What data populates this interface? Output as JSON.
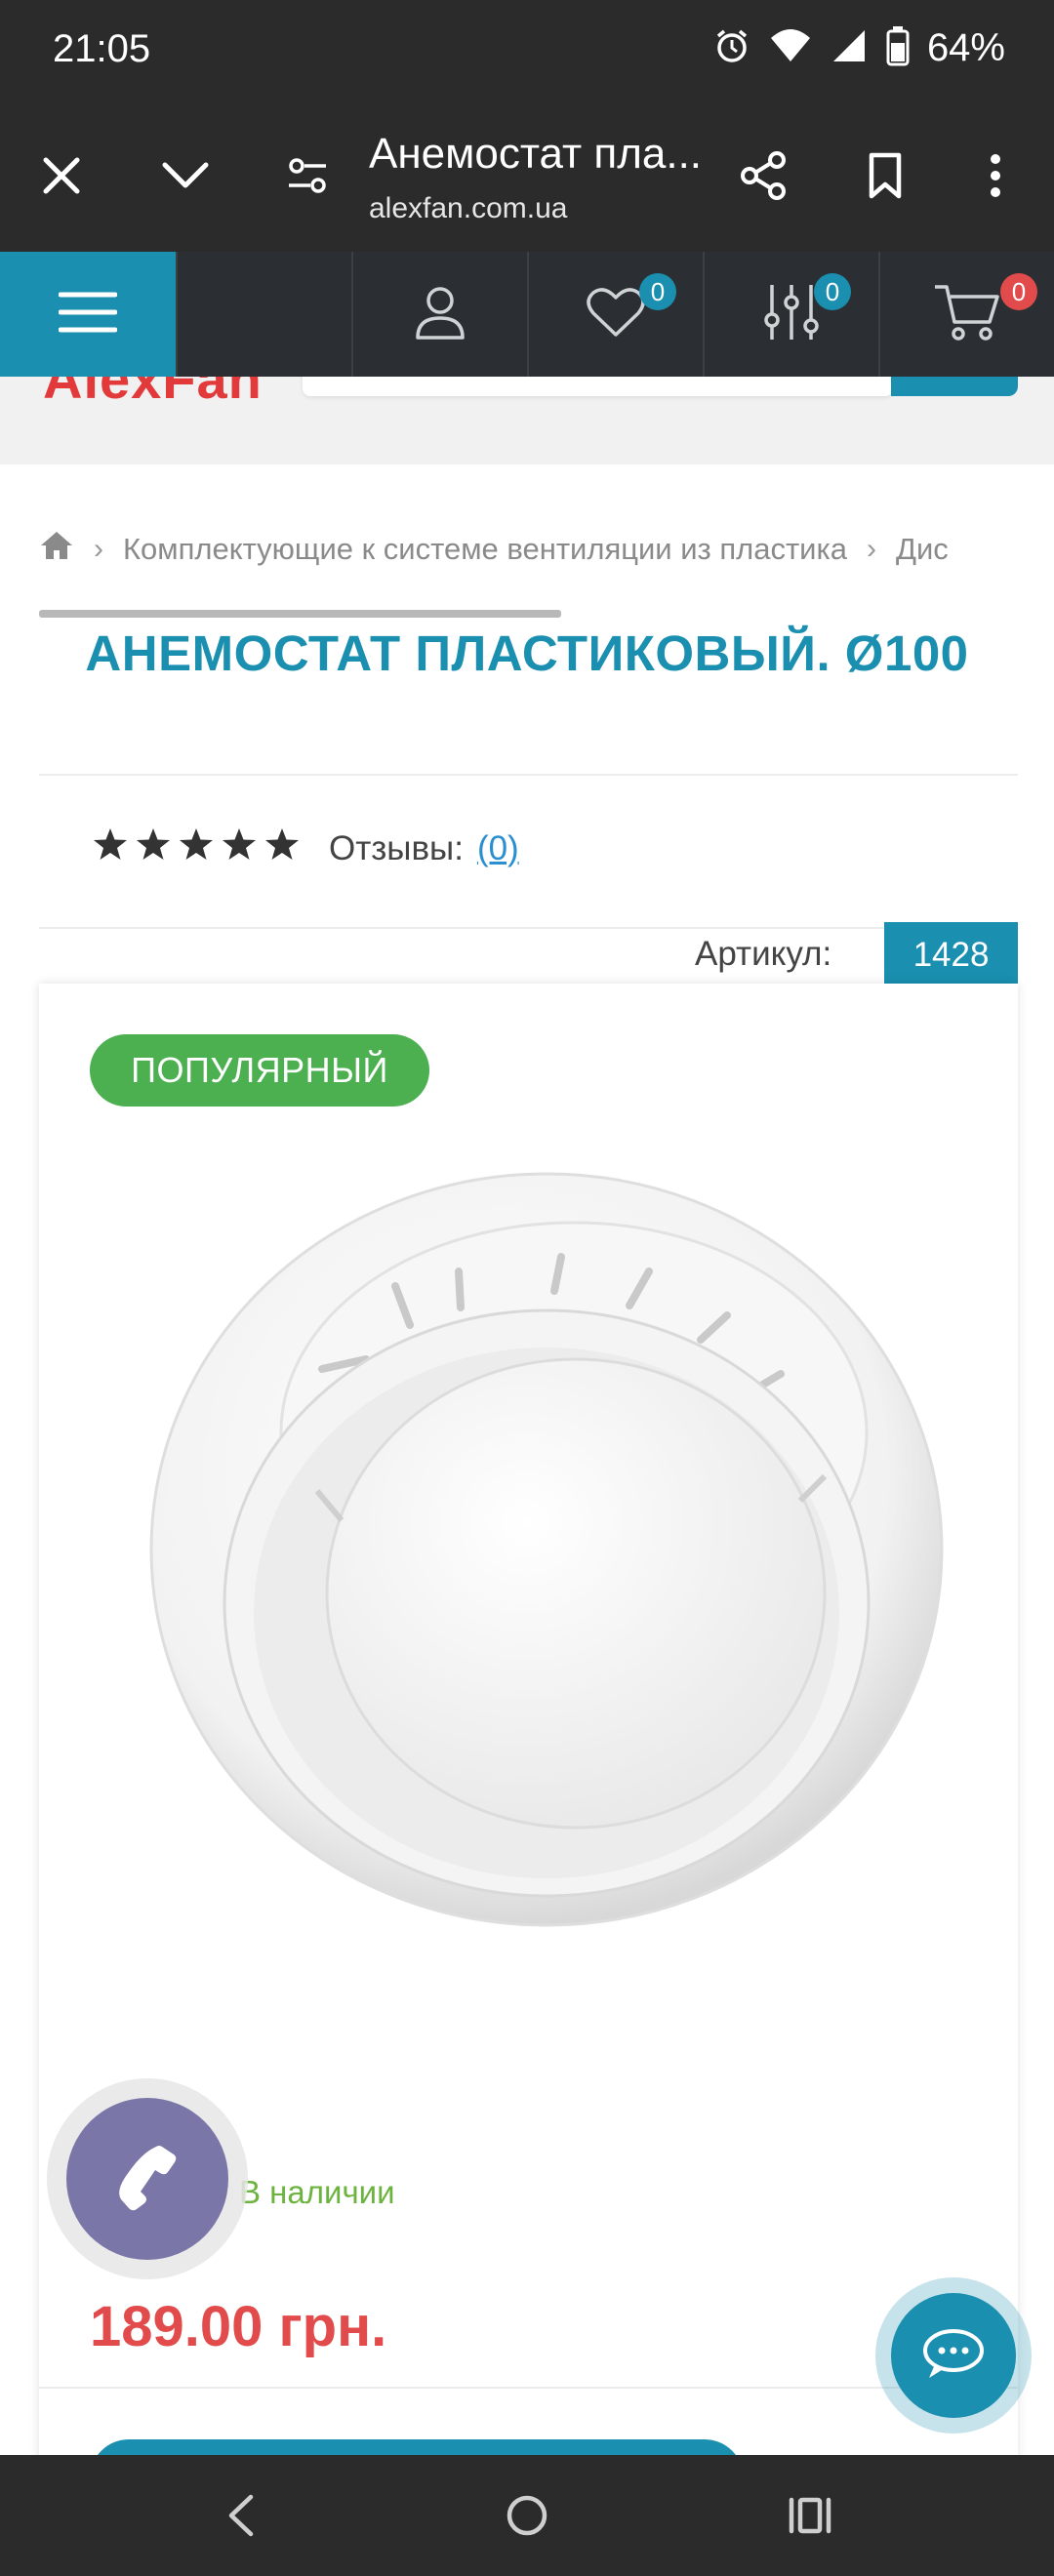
{
  "status_bar": {
    "time": "21:05",
    "battery": "64%"
  },
  "browser": {
    "title": "Анемостат пла...",
    "url": "alexfan.com.ua"
  },
  "header": {
    "wishlist_count": "0",
    "compare_count": "0",
    "cart_count": "0"
  },
  "logo": {
    "text": "AlexFan"
  },
  "breadcrumb": {
    "items": [
      "Комплектующие к системе вентиляции из пластика",
      "Дис"
    ]
  },
  "product": {
    "title": "АНЕМОСТАТ ПЛАСТИКОВЫЙ. Ø100",
    "reviews_label": "Отзывы:",
    "reviews_count": "(0)",
    "rating": 0,
    "rating_max": 5,
    "sku_label": "Артикул:",
    "sku": "1428",
    "badge": "ПОПУЛЯРНЫЙ",
    "availability": "В наличии",
    "price": "189.00 грн."
  },
  "colors": {
    "accent": "#1a8fb0",
    "price": "#e24b4b",
    "popular": "#4caf50",
    "in_stock": "#6cb33f",
    "call_button": "#7b76a8"
  }
}
